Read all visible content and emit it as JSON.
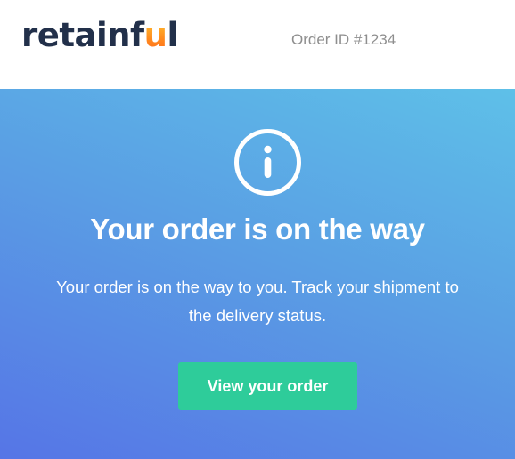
{
  "header": {
    "logo": {
      "text_main": "retainf",
      "text_accent": "u",
      "text_end": "l",
      "accent_color": "#ff8a1f"
    },
    "order_id": "Order ID #1234"
  },
  "hero": {
    "icon": "info-icon",
    "headline": "Your order is on the way",
    "message_line1": "Your order is on the way to you. Track your shipment to",
    "message_line2": "the delivery status.",
    "cta_label": "View your order",
    "colors": {
      "gradient_top": "#5ec0e8",
      "gradient_bottom": "#5675e6",
      "button": "#2ecc9a"
    }
  }
}
